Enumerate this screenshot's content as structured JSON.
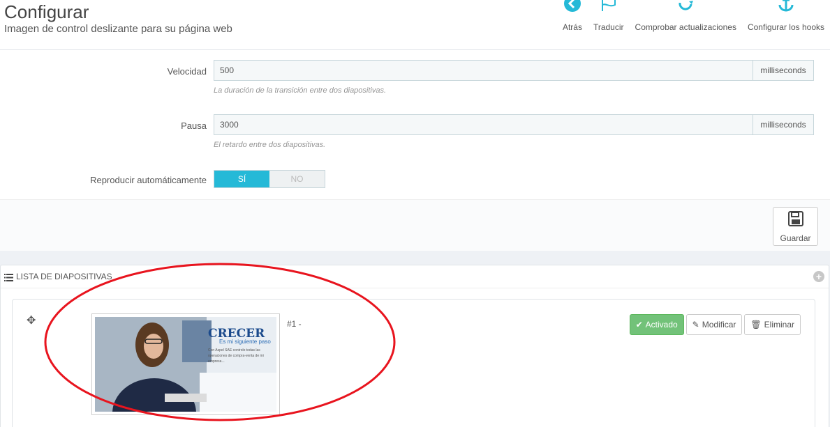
{
  "header": {
    "title": "Configurar",
    "subtitle": "Imagen de control deslizante para su página web"
  },
  "toolbar": [
    {
      "label": "Atrás",
      "icon": "back-icon"
    },
    {
      "label": "Traducir",
      "icon": "flag-icon"
    },
    {
      "label": "Comprobar actualizaciones",
      "icon": "refresh-icon"
    },
    {
      "label": "Configurar los hooks",
      "icon": "anchor-icon"
    }
  ],
  "form": {
    "speed": {
      "label": "Velocidad",
      "value": "500",
      "unit": "milliseconds",
      "help": "La duración de la transición entre dos diapositivas."
    },
    "pause": {
      "label": "Pausa",
      "value": "3000",
      "unit": "milliseconds",
      "help": "El retardo entre dos diapositivas."
    },
    "autoplay": {
      "label": "Reproducir automáticamente",
      "yes": "SÍ",
      "no": "NO",
      "selected": "yes"
    },
    "save_label": "Guardar"
  },
  "slides_panel": {
    "title": "Lista de diapositivas",
    "slides": [
      {
        "title": "#1 -",
        "image_text": {
          "heading": "CRECER",
          "tagline": "Es mi siguiente paso",
          "body": "Con Aspel SAE controlo todas las operaciones de compra-venta de mi empresa..."
        },
        "status_label": "Activado",
        "edit_label": "Modificar",
        "delete_label": "Eliminar"
      }
    ]
  },
  "colors": {
    "accent": "#25b9d7",
    "success": "#72c279",
    "annotation": "#e8141e"
  }
}
